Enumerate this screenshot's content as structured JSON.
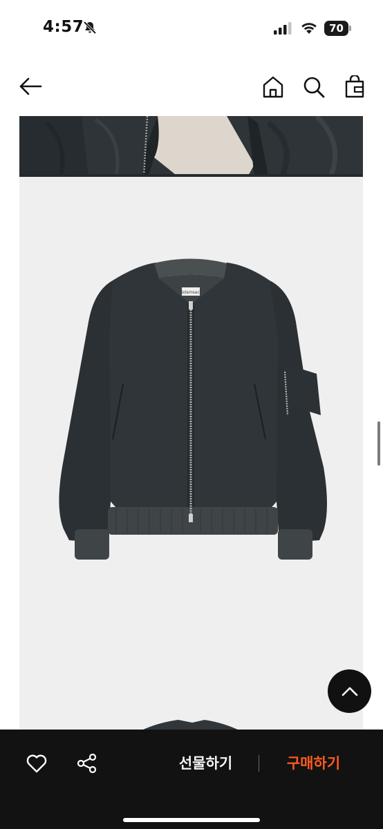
{
  "status_bar": {
    "time": "4:57",
    "battery": "70",
    "icons": [
      "bell-slash-icon",
      "signal-icon",
      "wifi-icon",
      "battery-icon"
    ]
  },
  "header": {
    "icons": [
      "back-arrow-icon",
      "home-icon",
      "search-icon",
      "shopping-bag-icon"
    ]
  },
  "product_images": {
    "label_text": "sisterreach",
    "images": [
      "product-photo-model-closeup",
      "product-photo-jacket-flatlay"
    ]
  },
  "floating": {
    "icon": "chevron-up-icon"
  },
  "bottom_bar": {
    "icons": [
      "heart-icon",
      "share-icon"
    ],
    "gift_label": "선물하기",
    "buy_label": "구매하기",
    "colors": {
      "background": "#121212",
      "buy": "#ff5a1f",
      "gift": "#f5f5f5"
    }
  }
}
